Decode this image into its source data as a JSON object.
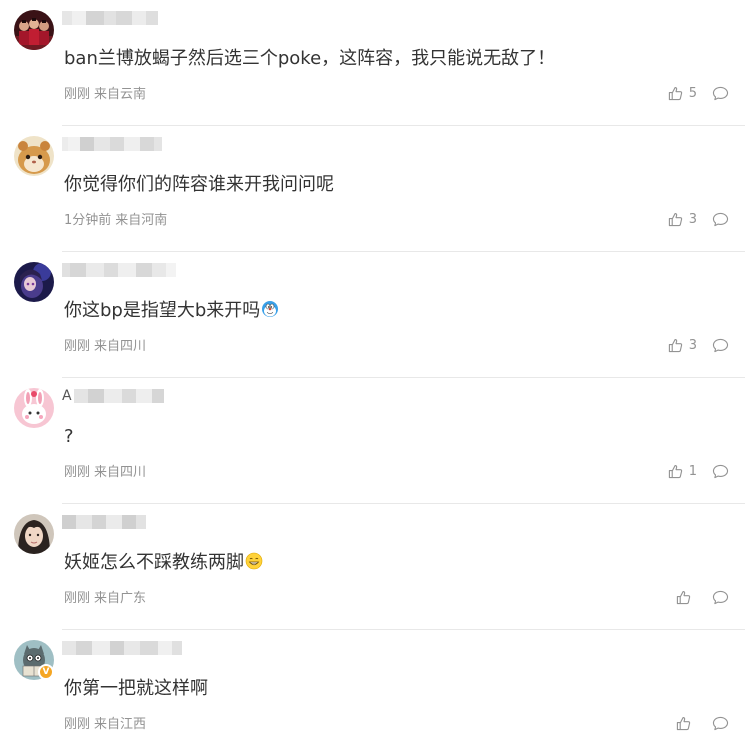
{
  "comments": [
    {
      "text": "ban兰博放蝎子然后选三个poke，这阵容，我只能说无敌了！",
      "time": "刚刚",
      "location": "来自云南",
      "likes": "5",
      "avatar_icon": "red-group-photo-avatar-icon"
    },
    {
      "text": "你觉得你们的阵容谁来开我问问呢",
      "time": "1分钟前",
      "location": "来自河南",
      "likes": "3",
      "avatar_icon": "hamster-avatar-icon"
    },
    {
      "text": "你这bp是指望大b来开吗",
      "time": "刚刚",
      "location": "来自四川",
      "likes": "3",
      "avatar_icon": "anime-dark-avatar-icon",
      "emoji": "doraemon-emoji-icon"
    },
    {
      "text": "?",
      "time": "刚刚",
      "location": "来自四川",
      "likes": "1",
      "avatar_icon": "pink-bunny-avatar-icon"
    },
    {
      "text": "妖姬怎么不踩教练两脚",
      "time": "刚刚",
      "location": "来自广东",
      "likes": "",
      "avatar_icon": "girl-photo-avatar-icon",
      "emoji": "grin-emoji-icon"
    },
    {
      "text": "你第一把就这样啊",
      "time": "刚刚",
      "location": "来自江西",
      "likes": "",
      "avatar_icon": "cartoon-reader-avatar-icon",
      "verified_badge": "V"
    }
  ],
  "colors": {
    "text": "#333333",
    "meta": "#939393",
    "divider": "#e8e8e8",
    "verified_badge": "#f5a623"
  }
}
